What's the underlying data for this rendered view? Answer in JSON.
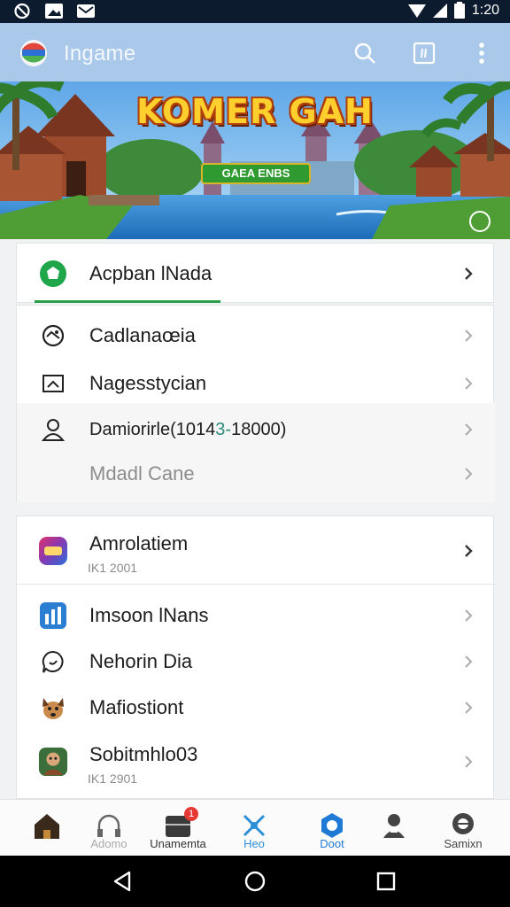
{
  "status_bar": {
    "icons": [
      "no-sim-icon",
      "photo-icon",
      "mail-icon",
      "wifi-icon",
      "signal-icon",
      "battery-icon"
    ],
    "time": "1:20"
  },
  "app_bar": {
    "title": "Ingame",
    "icons": [
      "search-icon",
      "screen-icon",
      "more-vert-icon"
    ],
    "background": "#a9c8ea"
  },
  "banner": {
    "title": "KOMER GAH",
    "badge": "GAEA ENBS"
  },
  "menu_top": {
    "items": [
      {
        "label": "Acpban lNada",
        "icon": "green-badge-icon"
      }
    ]
  },
  "menu_group1": {
    "items": [
      {
        "label": "Cadlanaœia",
        "icon": "gamepad-icon"
      },
      {
        "label": "Nagesstycian",
        "icon": "image-frame-icon"
      },
      {
        "label": "Damiorirle(1014",
        "label_highlight": "3-",
        "label_tail": "18000)",
        "icon": "person-icon"
      },
      {
        "label": "Mdadl Cane",
        "icon": "none"
      }
    ]
  },
  "menu_group2": {
    "items": [
      {
        "label": "Amrolatiem",
        "sub": "IK1 2001",
        "icon": "colorful-app-icon"
      },
      {
        "label": "Imsoon lNans",
        "icon": "chart-app-icon"
      },
      {
        "label": "Nehorin Dia",
        "icon": "chat-bubble-icon"
      },
      {
        "label": "Mafiostiont",
        "icon": "dog-app-icon"
      },
      {
        "label": "Sobitmhlo03",
        "sub": "IK1 2901",
        "icon": "avatar-app-icon"
      }
    ]
  },
  "bottom_nav": {
    "items": [
      {
        "label": "",
        "icon": "home-icon"
      },
      {
        "label": "Adomo",
        "icon": "headphones-icon"
      },
      {
        "label": "Unamemta",
        "icon": "inbox-icon",
        "badge": "1"
      },
      {
        "label": "Heo",
        "icon": "tools-icon"
      },
      {
        "label": "Doot",
        "icon": "hexagon-icon"
      },
      {
        "label": "",
        "icon": "profile-icon"
      },
      {
        "label": "Samixn",
        "icon": "settings-circle-icon"
      }
    ]
  },
  "system_nav": {
    "icons": [
      "back-icon",
      "home-circle-icon",
      "recents-icon"
    ]
  }
}
